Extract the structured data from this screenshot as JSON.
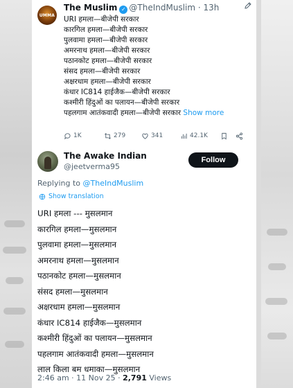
{
  "quoted_tweet": {
    "avatar_text": "UMMA",
    "name": "The Muslim",
    "handle": "@TheIndMuslim",
    "separator": " · ",
    "time": "13h",
    "lines": [
      "URI हमला—बीजेपी सरकार",
      "कारगिल हमला—बीजेपी सरकार",
      "पुलवामा हमला—बीजेपी सरकार",
      "अमरनाथ हमला—बीजेपी सरकार",
      "पठानकोट हमला—बीजेपी सरकार",
      "संसद हमला—बीजेपी सरकार",
      "अक्षरधाम हमला—बीजेपी सरकार",
      "कंधार IC814 हाईजैक—बीजेपी सरकार",
      "कश्मीरी हिंदुओं का पलायन—बीजेपी सरकार"
    ],
    "last_line": "पहलगाम आतंकवादी हमला—बीजेपी सरकार",
    "show_more": "Show more",
    "stats": {
      "replies": "1K",
      "reposts": "279",
      "likes": "341",
      "views": "42.1K"
    }
  },
  "main_tweet": {
    "name": "The Awake Indian",
    "handle": "@jeetverma95",
    "follow_label": "Follow",
    "replying_prefix": "Replying to ",
    "replying_to": "@TheIndMuslim",
    "show_translation": "Show translation",
    "lines": [
      "URI हमला --- मुसलमान",
      "कारगिल हमला—मुसलमान",
      "पुलवामा हमला—मुसलमान",
      "अमरनाथ हमला—मुसलमान",
      "पठानकोट हमला—मुसलमान",
      "संसद हमला—मुसलमान",
      "अक्षरधाम हमला—मुसलमान",
      "कंधार IC814 हाईजैक—मुसलमान",
      "कश्मीरी हिंदुओं का पलायन—मुसलमान",
      "पहलगाम आतंकवादी हमला—मुसलमान",
      "लाल किला बम धमाका—मुसलमान"
    ],
    "timestamp": "2:46 am · 11 Nov 25 · ",
    "views_count": "2,791",
    "views_label": " Views"
  },
  "colors": {
    "accent": "#1d9bf0",
    "text": "#0f1419",
    "muted": "#536471",
    "follow_bg": "#0f1419"
  },
  "icons": [
    "verified-badge-icon",
    "more-options-icon",
    "reply-icon",
    "repost-icon",
    "like-icon",
    "views-icon",
    "bookmark-icon",
    "share-icon",
    "translate-globe-icon"
  ]
}
